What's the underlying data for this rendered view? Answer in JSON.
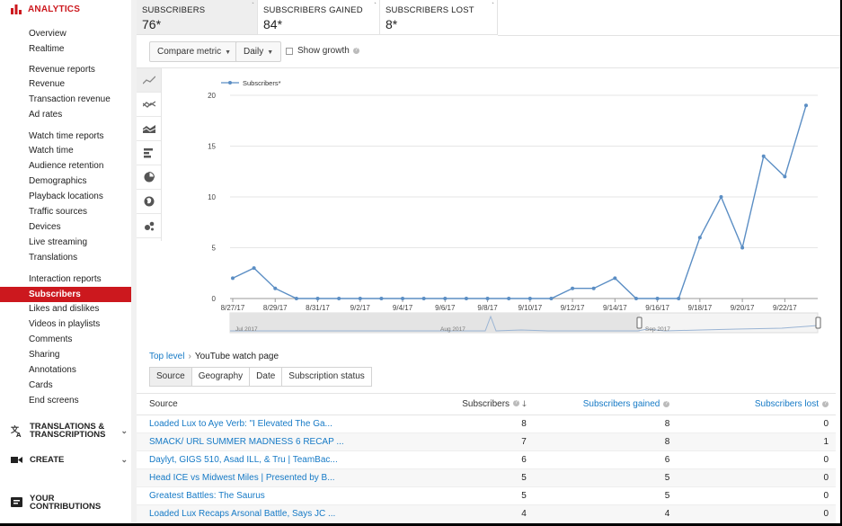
{
  "sidebar": {
    "analytics_label": "ANALYTICS",
    "items": [
      {
        "label": "Overview",
        "top": 32
      },
      {
        "label": "Realtime",
        "top": 48
      }
    ],
    "groups": [
      {
        "label": "Revenue reports"
      },
      {
        "label": "Revenue"
      },
      {
        "label": "Transaction revenue"
      },
      {
        "label": "Ad rates"
      },
      {
        "label": "Watch time reports"
      },
      {
        "label": "Watch time"
      },
      {
        "label": "Audience retention"
      },
      {
        "label": "Demographics"
      },
      {
        "label": "Playback locations"
      },
      {
        "label": "Traffic sources"
      },
      {
        "label": "Devices"
      },
      {
        "label": "Live streaming"
      },
      {
        "label": "Translations"
      },
      {
        "label": "Interaction reports"
      },
      {
        "label": "Subscribers"
      },
      {
        "label": "Likes and dislikes"
      },
      {
        "label": "Videos in playlists"
      },
      {
        "label": "Comments"
      },
      {
        "label": "Sharing"
      },
      {
        "label": "Annotations"
      },
      {
        "label": "Cards"
      },
      {
        "label": "End screens"
      }
    ],
    "translations_label_1": "TRANSLATIONS &",
    "translations_label_2": "TRANSCRIPTIONS",
    "create_label": "CREATE",
    "contributions_label_1": "YOUR",
    "contributions_label_2": "CONTRIBUTIONS"
  },
  "metrics": [
    {
      "label": "SUBSCRIBERS",
      "value": "76*"
    },
    {
      "label": "SUBSCRIBERS GAINED",
      "value": "84*"
    },
    {
      "label": "SUBSCRIBERS LOST",
      "value": "8*"
    }
  ],
  "controls": {
    "compare_metric": "Compare metric",
    "interval": "Daily",
    "show_growth": "Show growth"
  },
  "chart_data": {
    "type": "line",
    "legend": "Subscribers*",
    "x_tick_labels": [
      "8/27/17",
      "8/29/17",
      "8/31/17",
      "9/2/17",
      "9/4/17",
      "9/6/17",
      "9/8/17",
      "9/10/17",
      "9/12/17",
      "9/14/17",
      "9/16/17",
      "9/18/17",
      "9/20/17",
      "9/22/17"
    ],
    "y_ticks": [
      0,
      5,
      10,
      15,
      20
    ],
    "ylim": [
      0,
      20
    ],
    "x": [
      "8/27/17",
      "8/28/17",
      "8/29/17",
      "8/30/17",
      "8/31/17",
      "9/1/17",
      "9/2/17",
      "9/3/17",
      "9/4/17",
      "9/5/17",
      "9/6/17",
      "9/7/17",
      "9/8/17",
      "9/9/17",
      "9/10/17",
      "9/11/17",
      "9/12/17",
      "9/13/17",
      "9/14/17",
      "9/15/17",
      "9/16/17",
      "9/17/17",
      "9/18/17",
      "9/19/17",
      "9/20/17",
      "9/21/17",
      "9/22/17",
      "9/23/17"
    ],
    "values": [
      2,
      3,
      1,
      0,
      0,
      0,
      0,
      0,
      0,
      0,
      0,
      0,
      0,
      0,
      0,
      0,
      1,
      1,
      2,
      0,
      0,
      0,
      6,
      10,
      5,
      14,
      12,
      19
    ],
    "timeline_labels": [
      "Jul 2017",
      "Aug 2017",
      "Sep 2017"
    ],
    "grid": "horizontal"
  },
  "breadcrumb": {
    "top_level": "Top level",
    "separator": "›",
    "current": "YouTube watch page"
  },
  "filter_tabs": [
    "Source",
    "Geography",
    "Date",
    "Subscription status"
  ],
  "table": {
    "headers": {
      "source": "Source",
      "subscribers": "Subscribers",
      "gained": "Subscribers gained",
      "lost": "Subscribers lost"
    },
    "rows": [
      {
        "source": "Loaded Lux to Aye Verb: \"I Elevated The Ga...",
        "subscribers": "8",
        "gained": "8",
        "lost": "0"
      },
      {
        "source": "SMACK/ URL SUMMER MADNESS 6 RECAP ...",
        "subscribers": "7",
        "gained": "8",
        "lost": "1"
      },
      {
        "source": "Daylyt, GIGS 510, Asad ILL, & Tru | TeamBac...",
        "subscribers": "6",
        "gained": "6",
        "lost": "0"
      },
      {
        "source": "Head ICE vs Midwest Miles | Presented by B...",
        "subscribers": "5",
        "gained": "5",
        "lost": "0"
      },
      {
        "source": "Greatest Battles: The Saurus",
        "subscribers": "5",
        "gained": "5",
        "lost": "0"
      },
      {
        "source": "Loaded Lux Recaps Arsonal Battle, Says JC ...",
        "subscribers": "4",
        "gained": "4",
        "lost": "0"
      }
    ]
  },
  "colors": {
    "accent": "#cc181e",
    "link": "#167ac6",
    "series": "#5b8ec4"
  }
}
